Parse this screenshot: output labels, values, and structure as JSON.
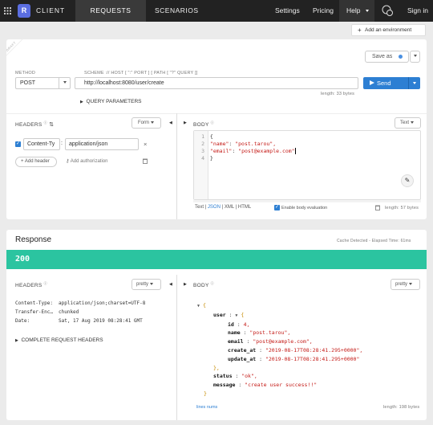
{
  "nav": {
    "brand": "CLIENT",
    "logo_letter": "R",
    "tabs": [
      "REQUESTS",
      "SCENARIOS"
    ],
    "settings": "Settings",
    "pricing": "Pricing",
    "help": "Help",
    "signin": "Sign in"
  },
  "toolbar": {
    "add_env": "Add an environment"
  },
  "request": {
    "draft": "DRAFT",
    "save_as": "Save as",
    "method_label": "METHOD",
    "method": "POST",
    "url_label": "SCHEME :// HOST [ \":\" PORT ] [ PATH [ \"?\" QUERY ]]",
    "url": "http://localhost:8080/user/create",
    "url_length": "length: 33 bytes",
    "send": "Send",
    "query_params": "QUERY PARAMETERS",
    "headers_title": "HEADERS",
    "form": "Form",
    "header_name": "Content-Ty",
    "header_value": "application/json",
    "add_header": "Add header",
    "add_auth": "Add authorization",
    "body_title": "BODY",
    "text": "Text",
    "body_lines": [
      {
        "n": "1",
        "t": "{"
      },
      {
        "n": "2",
        "k": "\"name\"",
        "v": "\"post.tarou\","
      },
      {
        "n": "3",
        "k": "\"email\"",
        "v": "\"post@example.com\""
      },
      {
        "n": "4",
        "t": "}"
      }
    ],
    "formats": [
      "Text",
      "JSON",
      "XML",
      "HTML"
    ],
    "enable_eval": "Enable body evaluation",
    "body_length": "length: 57 bytes"
  },
  "response": {
    "title": "Response",
    "cache": "Cache Detected - Elapsed Time: 61ms",
    "status": "200",
    "status_color": "#2bc4a0",
    "headers_title": "HEADERS",
    "pretty": "pretty",
    "headers": [
      {
        "k": "Content-Type:",
        "v": "application/json;charset=UTF-8"
      },
      {
        "k": "Transfer-Enc…",
        "v": "chunked"
      },
      {
        "k": "Date:",
        "v": "Sat, 17 Aug 2019 08:28:41 GMT"
      }
    ],
    "complete": "COMPLETE REQUEST HEADERS",
    "body_title": "BODY",
    "json": {
      "user": "user",
      "id_k": "id",
      "id_v": "4,",
      "name_k": "name",
      "name_v": "\"post.tarou\",",
      "email_k": "email",
      "email_v": "\"post@example.com\",",
      "create_k": "create_at",
      "create_v": "\"2019-08-17T08:28:41.295+0000\",",
      "update_k": "update_at",
      "update_v": "\"2019-08-17T08:28:41.295+0000\"",
      "status_k": "status",
      "status_v": "\"ok\",",
      "message_k": "message",
      "message_v": "\"create user success!!\""
    },
    "lines_nums": "lines nums",
    "length": "length: 198 bytes"
  }
}
